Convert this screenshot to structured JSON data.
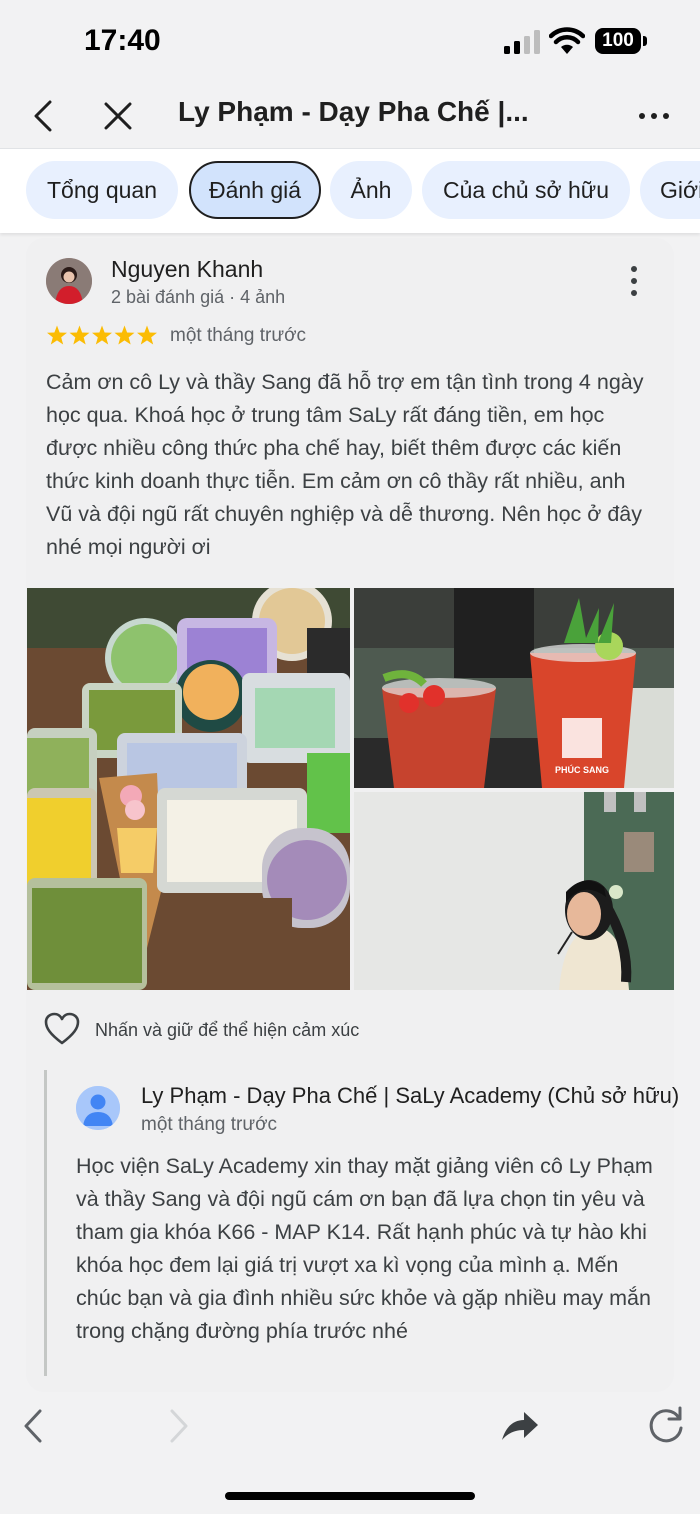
{
  "status_bar": {
    "time": "17:40",
    "battery": "100"
  },
  "header": {
    "title": "Ly Phạm - Dạy Pha Chế |..."
  },
  "tabs": [
    {
      "label": "Tổng quan",
      "active": false
    },
    {
      "label": "Đánh giá",
      "active": true
    },
    {
      "label": "Ảnh",
      "active": false
    },
    {
      "label": "Của chủ sở hữu",
      "active": false
    },
    {
      "label": "Giới",
      "active": false
    }
  ],
  "review": {
    "author": "Nguyen Khanh",
    "meta": "2 bài đánh giá · 4 ảnh",
    "rating": 5,
    "time": "một tháng trước",
    "text": "Cảm ơn cô Ly và thầy Sang đã hỗ trợ em tận tình trong 4 ngày học qua. Khoá học ở trung tâm SaLy rất đáng tiền, em học được nhiều công thức pha chế hay, biết thêm được các kiến thức kinh doanh thực tiễn. Em cảm ơn cô thầy rất nhiều, anh Vũ và đội ngũ rất chuyên nghiệp và dễ thương. Nên học ở đây nhé mọi người ơi",
    "photo_cup_text": "PHÚC SANG",
    "react_label": "Nhấn và giữ để thể hiện cảm xúc"
  },
  "owner_reply": {
    "name": "Ly Phạm - Dạy Pha Chế | SaLy Academy (Chủ sở hữu)",
    "time": "một tháng trước",
    "text": "Học viện SaLy Academy xin thay mặt giảng viên cô Ly Phạm và thầy Sang và đội ngũ cám ơn bạn đã lựa chọn tin yêu và tham gia khóa K66 - MAP K14. Rất hạnh phúc và tự hào khi khóa học đem lại giá trị vượt xa kì vọng của mình ạ. Mến chúc bạn và gia đình nhiều sức khỏe và gặp nhiều may mắn trong chặng đường phía trước nhé"
  },
  "colors": {
    "accent_tab": "#d2e3fc",
    "tab_bg": "#e8f0fe",
    "star": "#fbbc04"
  }
}
